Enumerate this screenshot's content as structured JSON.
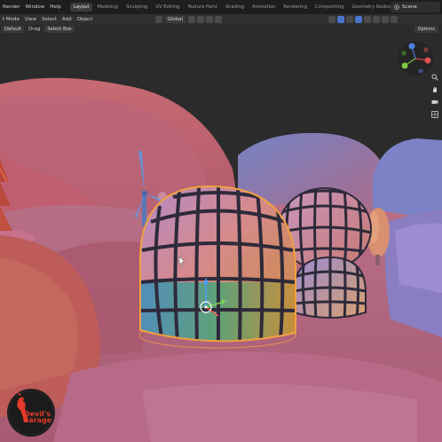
{
  "menubar": {
    "items": [
      "Render",
      "Window",
      "Help"
    ],
    "workspaces": [
      {
        "label": "Layout",
        "active": true
      },
      {
        "label": "Modeling",
        "active": false
      },
      {
        "label": "Sculpting",
        "active": false
      },
      {
        "label": "UV Editing",
        "active": false
      },
      {
        "label": "Texture Paint",
        "active": false
      },
      {
        "label": "Shading",
        "active": false
      },
      {
        "label": "Animation",
        "active": false
      },
      {
        "label": "Rendering",
        "active": false
      },
      {
        "label": "Compositing",
        "active": false
      },
      {
        "label": "Geometry Nodes",
        "active": false
      }
    ],
    "scene_label": "Scene"
  },
  "header": {
    "mode": "t Mode",
    "view": "View",
    "select": "Select",
    "add": "Add",
    "object": "Object",
    "orientation": "Global"
  },
  "toolbar": {
    "orientation_label": "Default",
    "drag_label": "Drag",
    "select_box_label": "Select Box",
    "options_label": "Options"
  },
  "watermark": {
    "line1": "Devil's",
    "line2": "Garage"
  },
  "colors": {
    "accent": "#4a74c9",
    "selection_outline": "#f0a040"
  }
}
